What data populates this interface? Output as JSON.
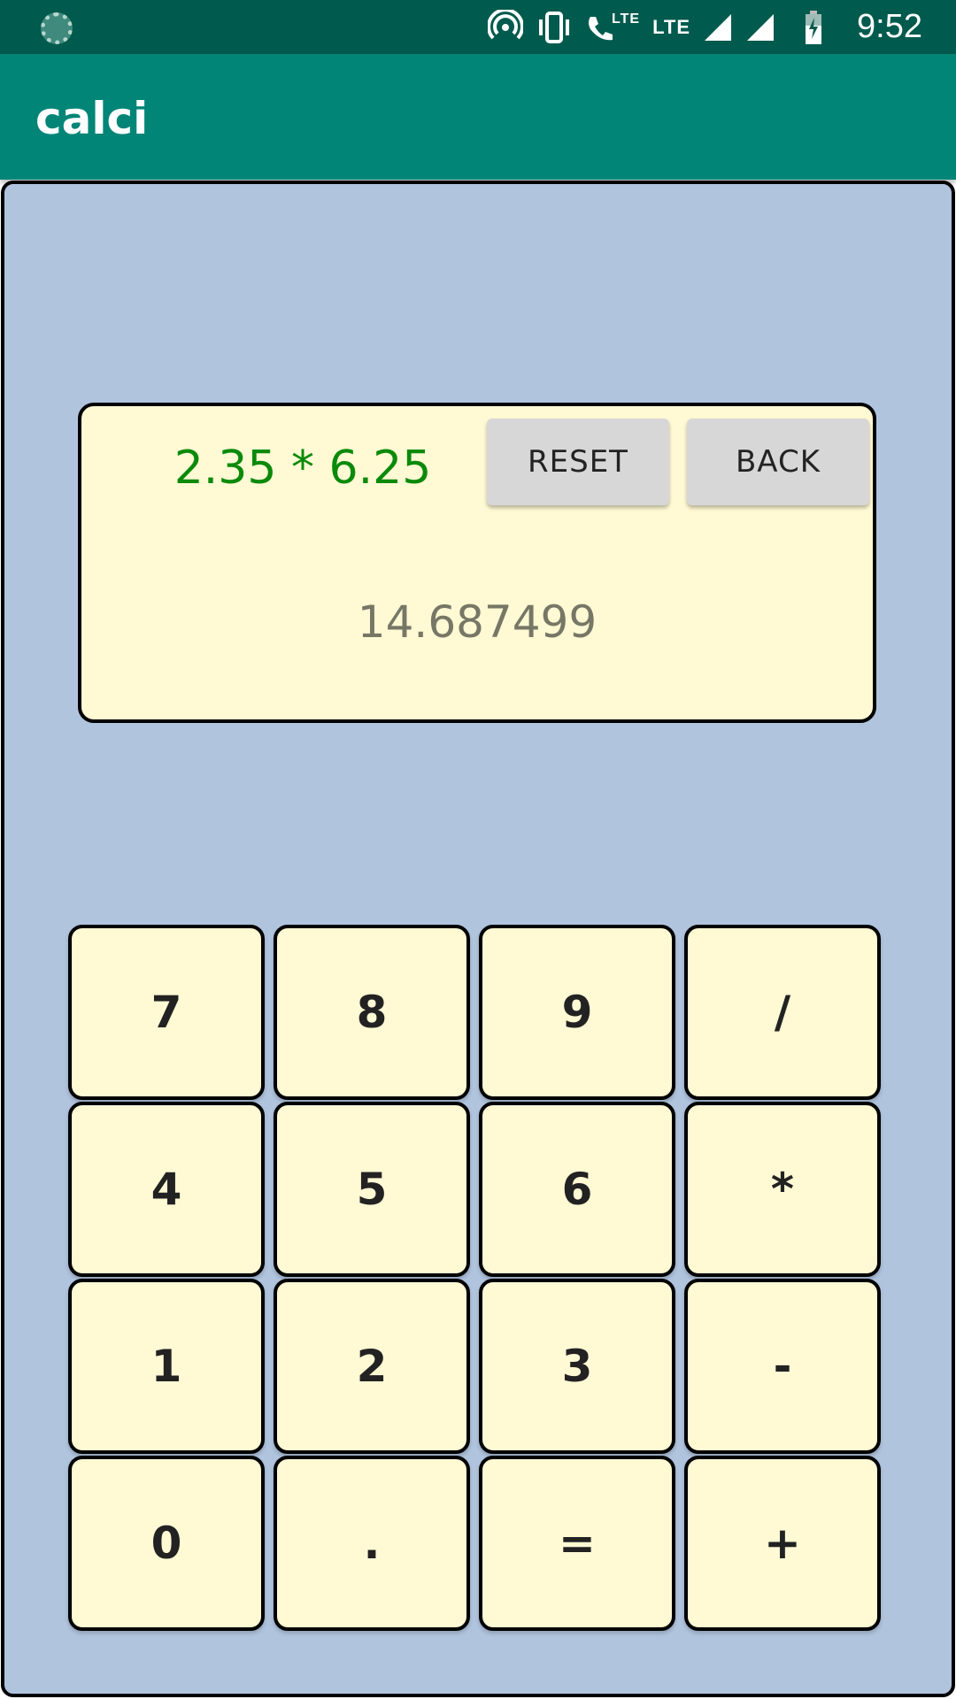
{
  "status_bar": {
    "time": "9:52",
    "lte_label_1": "LTE",
    "lte_label_2": "LTE",
    "icons": [
      "sync-icon",
      "hotspot-icon",
      "vibrate-icon",
      "call-lte-icon",
      "signal-icon",
      "signal-icon",
      "battery-charging-icon"
    ]
  },
  "app_bar": {
    "title": "calci"
  },
  "display": {
    "expression": "2.35 * 6.25",
    "result": "14.687499",
    "expression_color": "#0a8a0a",
    "result_color": "#777766"
  },
  "controls": {
    "reset_label": "RESET",
    "back_label": "BACK"
  },
  "keypad": {
    "rows": [
      [
        "7",
        "8",
        "9",
        "/"
      ],
      [
        "4",
        "5",
        "6",
        "*"
      ],
      [
        "1",
        "2",
        "3",
        "-"
      ],
      [
        "0",
        ".",
        "=",
        "+"
      ]
    ]
  },
  "colors": {
    "status_bar": "#005a4d",
    "app_bar": "#008577",
    "panel_bg": "#b0c4de",
    "key_bg": "#fff9d4",
    "control_button_bg": "#d7d7d7"
  }
}
